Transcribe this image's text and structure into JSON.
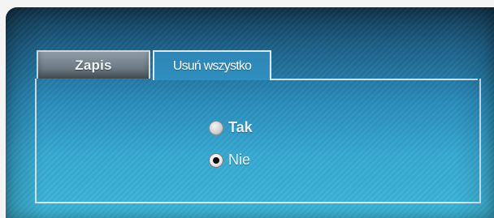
{
  "tabs": [
    {
      "label": "Zapis",
      "active": false
    },
    {
      "label": "Usuń wszystko",
      "active": true
    }
  ],
  "options": [
    {
      "label": "Tak",
      "selected": false
    },
    {
      "label": "Nie",
      "selected": true
    }
  ],
  "colors": {
    "screen_top": "#12364f",
    "screen_bottom": "#3db7d9",
    "inactive_tab": "#6f7e88",
    "panel_border": "#ebf5fa"
  }
}
